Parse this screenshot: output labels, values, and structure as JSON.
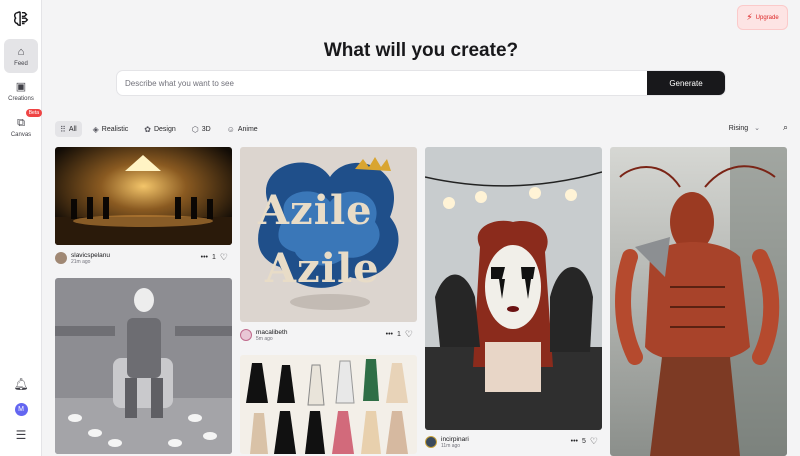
{
  "sidebar": {
    "logo": "brain-logo-icon",
    "items": [
      {
        "label": "Feed",
        "icon": "home-icon",
        "active": true
      },
      {
        "label": "Creations",
        "icon": "image-icon",
        "active": false
      },
      {
        "label": "Canvas",
        "icon": "canvas-icon",
        "badge": "Beta",
        "active": false
      }
    ],
    "avatar_initial": "M"
  },
  "header": {
    "upgrade_label": "Upgrade",
    "title": "What will you create?",
    "prompt_placeholder": "Describe what you want to see",
    "generate_label": "Generate"
  },
  "filters": {
    "chips": [
      {
        "label": "All",
        "icon": "grid-icon",
        "active": true
      },
      {
        "label": "Realistic",
        "icon": "cube-icon",
        "active": false
      },
      {
        "label": "Design",
        "icon": "palette-icon",
        "active": false
      },
      {
        "label": "3D",
        "icon": "box-icon",
        "active": false
      },
      {
        "label": "Anime",
        "icon": "smile-icon",
        "active": false
      }
    ],
    "sort_label": "Rising"
  },
  "feed": [
    {
      "user": "slavicspelanu",
      "ago": "21m ago",
      "likes": "1"
    },
    {
      "user": "macalibeth",
      "ago": "5m ago",
      "likes": "1"
    },
    {
      "user": "incirpinari",
      "ago": "11m ago",
      "likes": "5"
    }
  ],
  "colors": {
    "accent": "#18181b",
    "upgrade": "#dc2626",
    "avatar": "#6366f1"
  }
}
